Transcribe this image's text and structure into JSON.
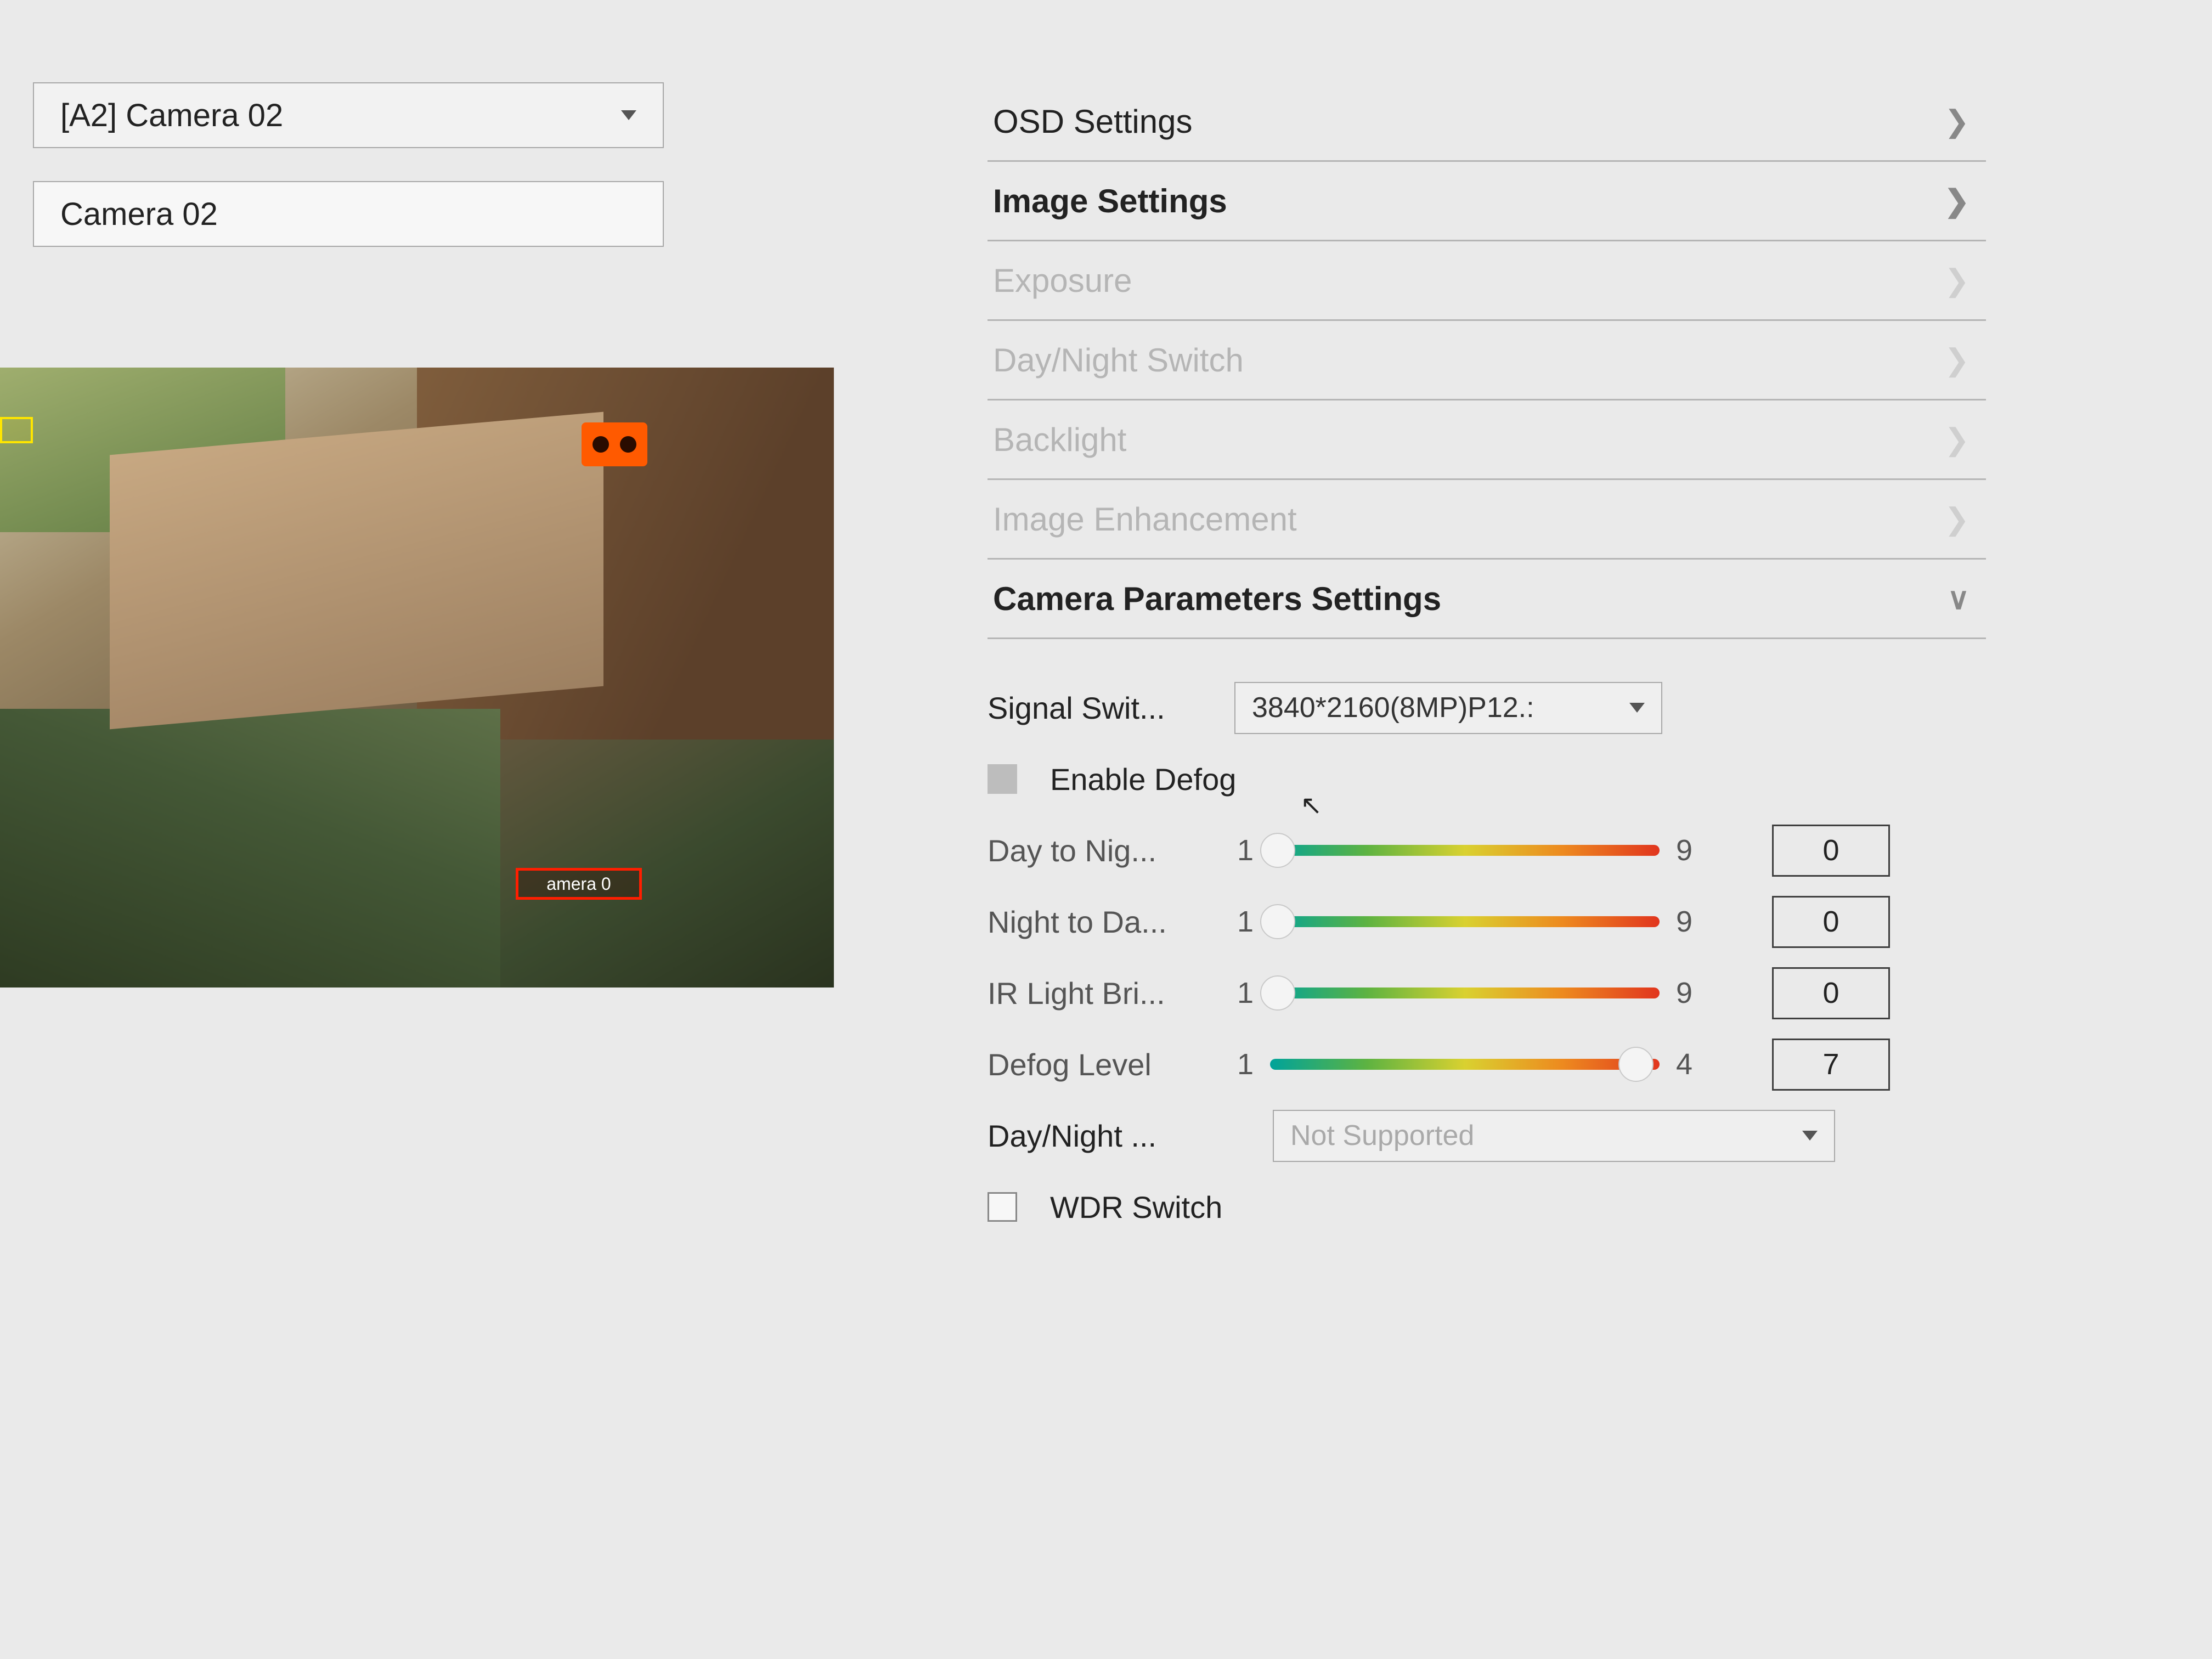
{
  "camera_select": "[A2] Camera 02",
  "camera_name": "Camera 02",
  "preview": {
    "red_label_text": "amera 0"
  },
  "sections": {
    "osd": "OSD Settings",
    "image": "Image Settings",
    "exposure": "Exposure",
    "day_night_switch": "Day/Night Switch",
    "backlight": "Backlight",
    "image_enhancement": "Image Enhancement",
    "camera_params": "Camera Parameters Settings"
  },
  "params": {
    "signal_switch_label": "Signal Swit...",
    "signal_switch_value": "3840*2160(8MP)P12.:",
    "enable_defog_label": "Enable Defog",
    "sliders": [
      {
        "label": "Day to Nig...",
        "min": "1",
        "max": "9",
        "value": "0",
        "thumb_pct": 2
      },
      {
        "label": "Night to Da...",
        "min": "1",
        "max": "9",
        "value": "0",
        "thumb_pct": 2
      },
      {
        "label": "IR Light Bri...",
        "min": "1",
        "max": "9",
        "value": "0",
        "thumb_pct": 2
      },
      {
        "label": "Defog Level",
        "min": "1",
        "max": "4",
        "value": "7",
        "thumb_pct": 94
      }
    ],
    "day_night_label": "Day/Night ...",
    "day_night_value": "Not Supported",
    "wdr_switch_label": "WDR Switch"
  }
}
